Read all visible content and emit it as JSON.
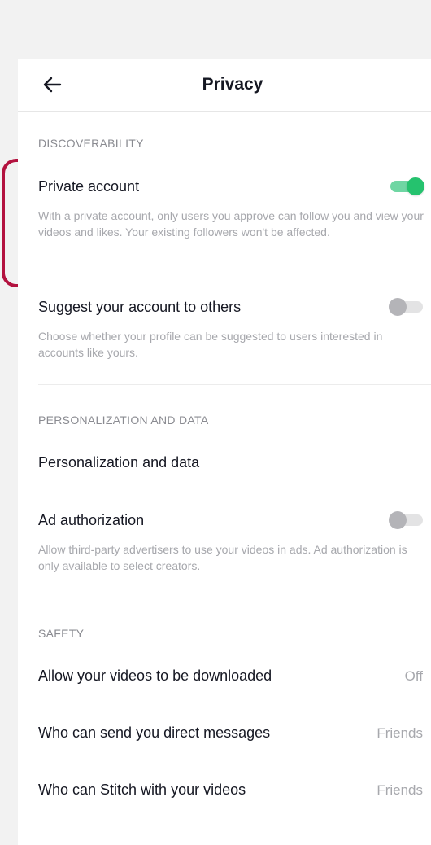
{
  "header": {
    "title": "Privacy",
    "back_icon": "arrow-left-icon"
  },
  "sections": {
    "discoverability": "DISCOVERABILITY",
    "personalization": "PERSONALIZATION AND DATA",
    "safety": "SAFETY"
  },
  "settings": {
    "private_account": {
      "title": "Private account",
      "description": "With a private account, only users you approve can follow you and view your videos and likes. Your existing followers won't be affected.",
      "enabled": true
    },
    "suggest_account": {
      "title": "Suggest your account to others",
      "description": "Choose whether your profile can be suggested to users interested in accounts like yours.",
      "enabled": false
    },
    "personalization_data": {
      "title": "Personalization and data"
    },
    "ad_authorization": {
      "title": "Ad authorization",
      "description": "Allow third-party advertisers to use your videos in ads. Ad authorization is only available to select creators.",
      "enabled": false
    },
    "allow_downloads": {
      "title": "Allow your videos to be downloaded",
      "value": "Off"
    },
    "direct_messages": {
      "title": "Who can send you direct messages",
      "value": "Friends"
    },
    "stitch": {
      "title": "Who can Stitch with your videos",
      "value": "Friends"
    }
  },
  "colors": {
    "toggle_on": "#25c26e",
    "toggle_off": "#b4b4b8",
    "highlight": "#b3123f"
  }
}
